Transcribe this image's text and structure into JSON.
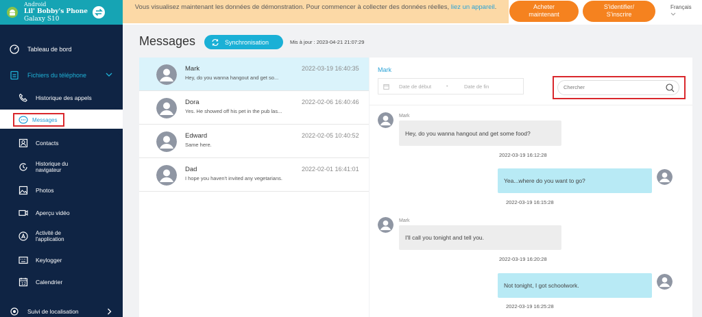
{
  "device": {
    "os": "Android",
    "name": "Lil' Bobby's Phone",
    "model": "Galaxy S10"
  },
  "banner": {
    "notice_text": "Vous visualisez maintenant les données de démonstration. Pour commencer à collecter des données réelles,",
    "notice_link": "liez un appareil",
    "notice_end": ".",
    "buy_line1": "Acheter",
    "buy_line2": "maintenant",
    "login_line1": "S'identifier/",
    "login_line2": "S'inscrire",
    "language": "Français"
  },
  "sidebar": {
    "dashboard": "Tableau de bord",
    "phone_files": "Fichiers du téléphone",
    "call_history": "Historique des appels",
    "messages": "Messages",
    "contacts": "Contacts",
    "browser_line1": "Historique du",
    "browser_line2": "navigateur",
    "photos": "Photos",
    "video": "Aperçu vidéo",
    "app_line1": "Activité de",
    "app_line2": "l'application",
    "keylogger": "Keylogger",
    "calendar": "Calendrier",
    "location": "Suivi de localisation"
  },
  "header": {
    "title": "Messages",
    "sync_label": "Synchronisation",
    "updated": "Mis à jour : 2023-04-21 21:07:29"
  },
  "conversations": [
    {
      "name": "Mark",
      "preview": "Hey, do you wanna hangout and get so...",
      "date": "2022-03-19 16:40:35"
    },
    {
      "name": "Dora",
      "preview": "Yes. He showed off his pet in the pub las...",
      "date": "2022-02-06 16:40:46"
    },
    {
      "name": "Edward",
      "preview": "Same here.",
      "date": "2022-02-05 10:40:52"
    },
    {
      "name": "Dad",
      "preview": "I hope you haven't invited any vegetarians.",
      "date": "2022-02-01 16:41:01"
    }
  ],
  "chat": {
    "contact": "Mark",
    "start_placeholder": "Date de début",
    "date_sep": "-",
    "end_placeholder": "Date de fin",
    "search_placeholder": "Chercher",
    "messages": [
      {
        "sender": "Mark",
        "text": "Hey, do you wanna hangout and get some food?",
        "time": "2022-03-19 16:12:28"
      },
      {
        "text": "Yea...where do you want to go?",
        "time": "2022-03-19 16:15:28"
      },
      {
        "sender": "Mark",
        "text": "I'll call you tonight and tell you.",
        "time": "2022-03-19 16:20:28"
      },
      {
        "text": "Not tonight, I got schoolwork.",
        "time": "2022-03-19 16:25:28"
      }
    ]
  },
  "colors": {
    "sidebar": "#0f2444",
    "accent": "#16a4b4",
    "orange": "#f5821f",
    "notice": "#fcd9a6",
    "selected_row": "#daf3fb",
    "outgoing_bubble": "#b8eaf5",
    "highlight_border": "#d9262b"
  }
}
